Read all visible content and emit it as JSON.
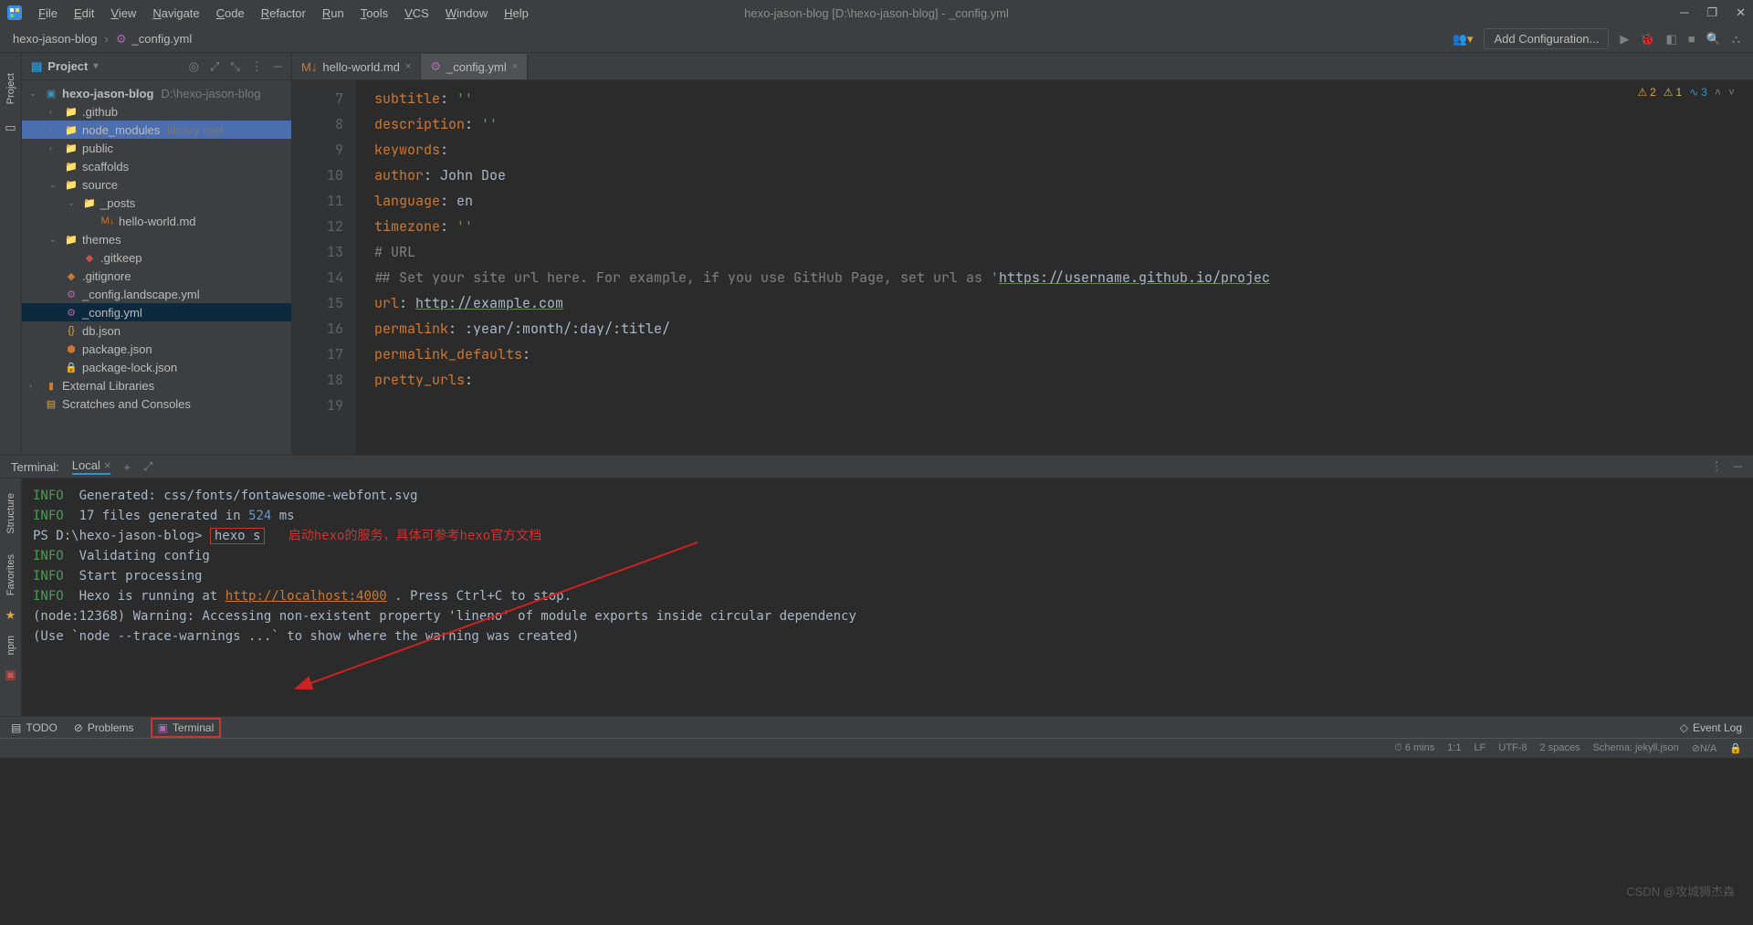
{
  "titlebar": {
    "menus": [
      "File",
      "Edit",
      "View",
      "Navigate",
      "Code",
      "Refactor",
      "Run",
      "Tools",
      "VCS",
      "Window",
      "Help"
    ],
    "title": "hexo-jason-blog [D:\\hexo-jason-blog] - _config.yml"
  },
  "navbar": {
    "breadcrumb": [
      "hexo-jason-blog",
      "_config.yml"
    ],
    "add_config": "Add Configuration..."
  },
  "project": {
    "title": "Project",
    "root": {
      "name": "hexo-jason-blog",
      "hint": "D:\\hexo-jason-blog"
    },
    "items": [
      {
        "ind": 1,
        "arrow": "›",
        "icon": "📁",
        "color": "fi-blue",
        "name": ".github"
      },
      {
        "ind": 1,
        "arrow": "›",
        "icon": "📁",
        "color": "fi-yellow",
        "name": "node_modules",
        "hint": "library root",
        "hl": true
      },
      {
        "ind": 1,
        "arrow": "›",
        "icon": "📁",
        "color": "fi-blue",
        "name": "public"
      },
      {
        "ind": 1,
        "arrow": "",
        "icon": "📁",
        "color": "fi-grey",
        "name": "scaffolds"
      },
      {
        "ind": 1,
        "arrow": "⌄",
        "icon": "📁",
        "color": "fi-blue",
        "name": "source"
      },
      {
        "ind": 2,
        "arrow": "⌄",
        "icon": "📁",
        "color": "fi-orange",
        "name": "_posts"
      },
      {
        "ind": 3,
        "arrow": "",
        "icon": "M↓",
        "color": "fi-orange",
        "name": "hello-world.md"
      },
      {
        "ind": 1,
        "arrow": "⌄",
        "icon": "📁",
        "color": "fi-blue",
        "name": "themes"
      },
      {
        "ind": 2,
        "arrow": "",
        "icon": "◆",
        "color": "fi-red",
        "name": ".gitkeep"
      },
      {
        "ind": 1,
        "arrow": "",
        "icon": "◆",
        "color": "fi-orange",
        "name": ".gitignore"
      },
      {
        "ind": 1,
        "arrow": "",
        "icon": "⚙",
        "color": "fi-purple",
        "name": "_config.landscape.yml"
      },
      {
        "ind": 1,
        "arrow": "",
        "icon": "⚙",
        "color": "fi-purple",
        "name": "_config.yml",
        "sel": true
      },
      {
        "ind": 1,
        "arrow": "",
        "icon": "{}",
        "color": "fi-yellow",
        "name": "db.json"
      },
      {
        "ind": 1,
        "arrow": "",
        "icon": "⬢",
        "color": "fi-orange",
        "name": "package.json"
      },
      {
        "ind": 1,
        "arrow": "",
        "icon": "🔒",
        "color": "fi-red",
        "name": "package-lock.json"
      }
    ],
    "extlib": "External Libraries",
    "scratches": "Scratches and Consoles"
  },
  "editor": {
    "tabs": [
      {
        "icon": "M↓",
        "color": "fi-orange",
        "name": "hello-world.md",
        "active": false
      },
      {
        "icon": "⚙",
        "color": "fi-purple",
        "name": "_config.yml",
        "active": true
      }
    ],
    "inspections": {
      "warn1": "2",
      "warn2": "1",
      "info": "3"
    },
    "lines": [
      {
        "n": 7,
        "k": "subtitle",
        "v": "''",
        "t": "str"
      },
      {
        "n": 8,
        "k": "description",
        "v": "''",
        "t": "str"
      },
      {
        "n": 9,
        "k": "keywords",
        "v": "",
        "t": "txt"
      },
      {
        "n": 10,
        "k": "author",
        "v": "John Doe",
        "t": "txt"
      },
      {
        "n": 11,
        "k": "language",
        "v": "en",
        "t": "txt"
      },
      {
        "n": 12,
        "k": "timezone",
        "v": "''",
        "t": "str"
      },
      {
        "n": 13,
        "raw": ""
      },
      {
        "n": 14,
        "raw": "# URL",
        "cls": "cmt"
      },
      {
        "n": 15,
        "raw": "## Set your site url here. For example, if you use GitHub Page, set url as 'https://username.github.io/projec",
        "cls": "cmt",
        "link": "https://username.github.io/projec"
      },
      {
        "n": 16,
        "k": "url",
        "v": "http://example.com",
        "t": "link"
      },
      {
        "n": 17,
        "k": "permalink",
        "v": ":year/:month/:day/:title/",
        "t": "txt"
      },
      {
        "n": 18,
        "k": "permalink_defaults",
        "v": "",
        "t": "txt"
      },
      {
        "n": 19,
        "k": "pretty_urls",
        "v": "",
        "t": "txt"
      }
    ]
  },
  "terminal": {
    "title": "Terminal:",
    "tab": "Local",
    "lines": [
      {
        "p": "INFO",
        "t": "  Generated: css/fonts/fontawesome-webfont.svg"
      },
      {
        "p": "INFO",
        "t": "  17 files generated in ",
        "num": "524",
        "sfx": " ms"
      },
      {
        "prompt": "PS D:\\hexo-jason-blog> ",
        "cmd": "hexo s",
        "anno": "启动hexo的服务，具体可参考hexo官方文档"
      },
      {
        "p": "INFO",
        "t": "  Validating config"
      },
      {
        "p": "INFO",
        "t": "  Start processing"
      },
      {
        "p": "",
        "t": ""
      },
      {
        "p": "INFO",
        "t": "  Hexo is running at ",
        "link": "http://localhost:4000",
        "sfx": " . Press Ctrl+C to stop."
      },
      {
        "raw": "(node:12368) Warning: Accessing non-existent property 'lineno' of module exports inside circular dependency"
      },
      {
        "raw": "(Use `node --trace-warnings ...` to show where the warning was created)"
      }
    ]
  },
  "bottombar": {
    "todo": "TODO",
    "problems": "Problems",
    "terminal": "Terminal",
    "eventlog": "Event Log"
  },
  "statusbar": {
    "items": [
      "6 mins",
      "1:1",
      "LF",
      "UTF-8",
      "2 spaces",
      "Schema: jekyll.json",
      "⊘N/A"
    ]
  },
  "watermark": "CSDN @攻城狮杰森"
}
